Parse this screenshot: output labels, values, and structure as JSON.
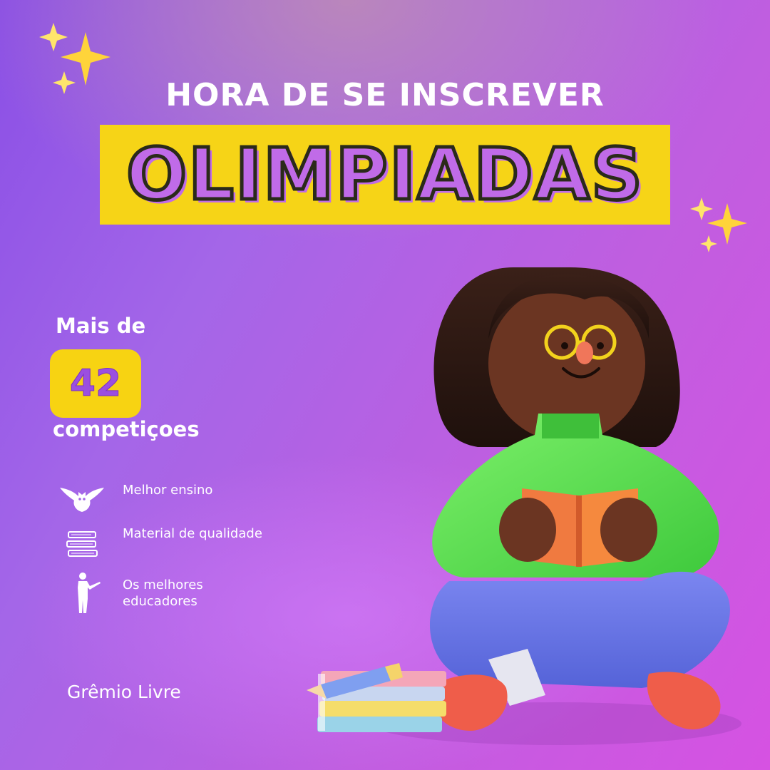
{
  "header": {
    "headline": "HORA DE SE INSCREVER",
    "banner_title": "OLIMPIADAS"
  },
  "stats": {
    "prefix": "Mais de",
    "count": "42",
    "suffix": "competiçoes"
  },
  "features": [
    {
      "icon": "owl-icon",
      "label": "Melhor ensino"
    },
    {
      "icon": "book-stack-icon",
      "label": "Material de qualidade"
    },
    {
      "icon": "teacher-pointer-icon",
      "label": "Os melhores educadores"
    }
  ],
  "footer": {
    "brand": "Grêmio Livre"
  },
  "colors": {
    "banner_yellow": "#f6d417",
    "title_purple": "#c06be8",
    "count_box_yellow": "#f7d312",
    "background_purple": "#a466e8",
    "background_magenta": "#d652e2"
  },
  "illustration": {
    "name": "student-reading-illustration",
    "icons": [
      "sparkle-icon",
      "sparkle-icon",
      "pencil-icon",
      "book-stack-icon"
    ]
  }
}
